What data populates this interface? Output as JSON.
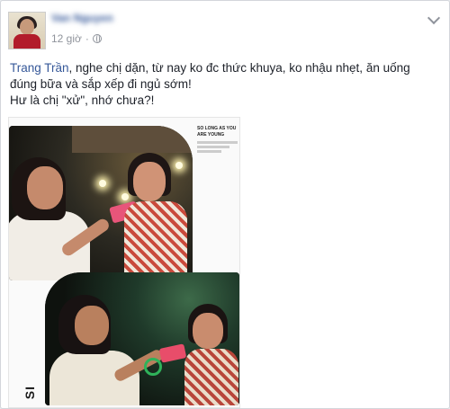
{
  "post": {
    "author": "Van Nguyen",
    "time": "12 giờ",
    "separator": "·",
    "text": {
      "mention": "Trang Trần",
      "line1_rest": ", nghe chị dặn, từ nay ko đc thức khuya, ko nhậu nhẹt, ăn uống",
      "line2": "đúng bữa và sắp xếp đi ngủ sớm!",
      "line3": "Hư là chị \"xử\", nhớ chưa?!"
    },
    "photo": {
      "caption_title": "SO LONG AS YOU ARE YOUNG",
      "side_text": "SI"
    }
  },
  "icons": {
    "privacy": "globe-icon",
    "options": "chevron-down-icon"
  },
  "colors": {
    "link": "#365899",
    "meta": "#90949c",
    "text": "#1d2129"
  }
}
